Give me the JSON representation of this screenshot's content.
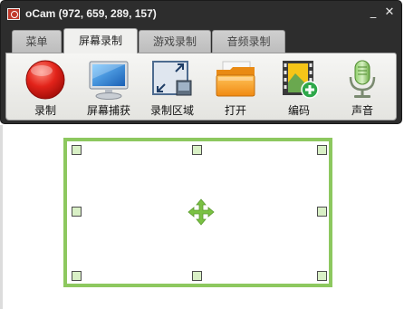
{
  "window": {
    "title": "oCam (972, 659, 289, 157)",
    "minimize_glyph": "_",
    "close_glyph": "✕"
  },
  "tabs": [
    {
      "label": "菜单",
      "active": false
    },
    {
      "label": "屏幕录制",
      "active": true
    },
    {
      "label": "游戏录制",
      "active": false
    },
    {
      "label": "音频录制",
      "active": false
    }
  ],
  "toolbar": {
    "items": [
      {
        "label": "录制",
        "icon": "record-icon"
      },
      {
        "label": "屏幕捕获",
        "icon": "monitor-icon"
      },
      {
        "label": "录制区域",
        "icon": "resize-region-icon"
      },
      {
        "label": "打开",
        "icon": "folder-icon"
      },
      {
        "label": "编码",
        "icon": "film-add-icon"
      },
      {
        "label": "声音",
        "icon": "microphone-icon"
      }
    ]
  },
  "colors": {
    "selection_border": "#8dc85f",
    "handle_fill": "#d9f0c6",
    "move_icon": "#7ac143"
  }
}
